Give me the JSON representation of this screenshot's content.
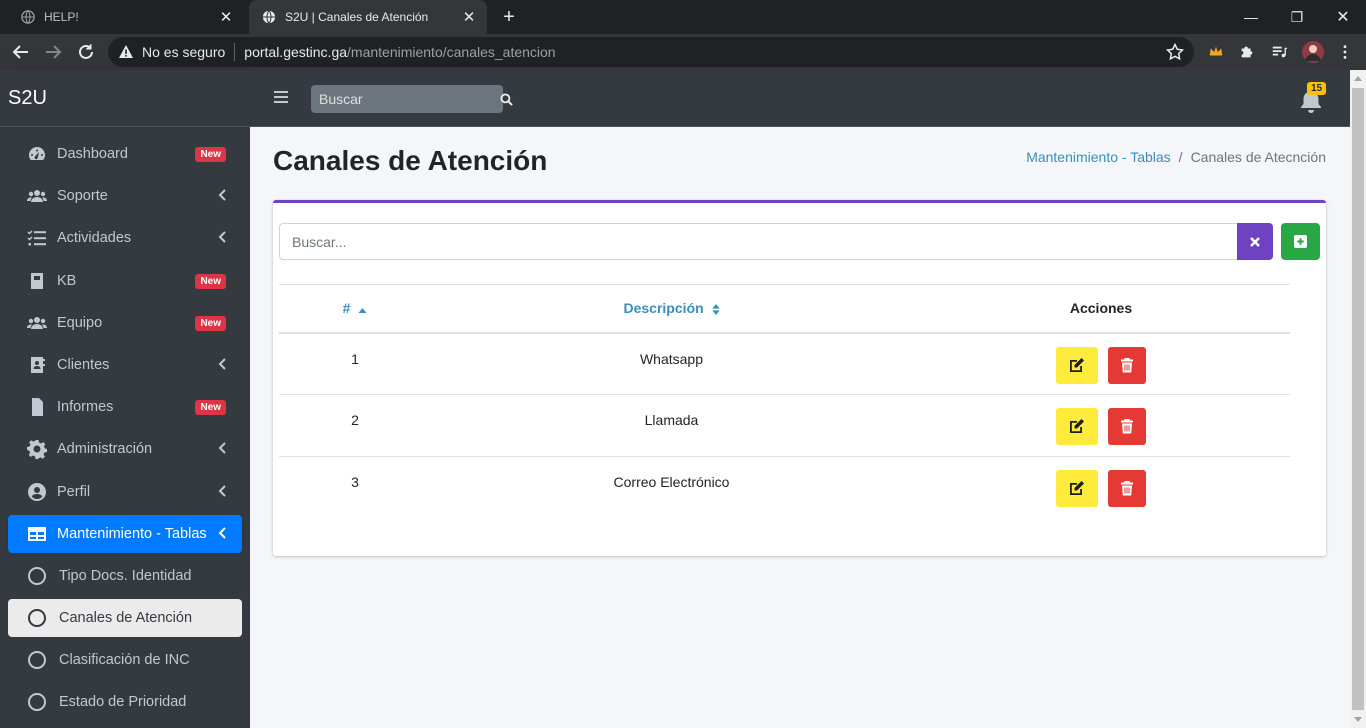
{
  "browser": {
    "tabs": [
      {
        "title": "HELP!",
        "active": false
      },
      {
        "title": "S2U | Canales de Atención",
        "active": true
      }
    ],
    "security_label": "No es seguro",
    "url_host": "portal.gestinc.ga",
    "url_path": "/mantenimiento/canales_atencion"
  },
  "app": {
    "brand": "S2U",
    "search_placeholder": "Buscar",
    "notifications_count": "15"
  },
  "sidebar": {
    "items": [
      {
        "label": "Dashboard",
        "icon": "tachometer-icon",
        "badge": "New"
      },
      {
        "label": "Soporte",
        "icon": "users-icon",
        "chevron": true
      },
      {
        "label": "Actividades",
        "icon": "tasks-icon",
        "chevron": true
      },
      {
        "label": "KB",
        "icon": "book-icon",
        "badge": "New"
      },
      {
        "label": "Equipo",
        "icon": "users-icon",
        "badge": "New"
      },
      {
        "label": "Clientes",
        "icon": "address-book-icon",
        "chevron": true
      },
      {
        "label": "Informes",
        "icon": "file-icon",
        "badge": "New"
      },
      {
        "label": "Administración",
        "icon": "cog-icon",
        "chevron": true
      },
      {
        "label": "Perfil",
        "icon": "user-circle-icon",
        "chevron": true
      },
      {
        "label": "Mantenimiento - Tablas",
        "icon": "table-icon",
        "chevron": true,
        "active": true
      },
      {
        "label": "Tipo Docs. Identidad",
        "icon": "circle-icon"
      },
      {
        "label": "Canales de Atención",
        "icon": "circle-icon",
        "selected": true
      },
      {
        "label": "Clasificación de INC",
        "icon": "circle-icon"
      },
      {
        "label": "Estado de Prioridad",
        "icon": "circle-icon"
      }
    ]
  },
  "page": {
    "title": "Canales de Atención",
    "breadcrumb": {
      "parent": "Mantenimiento - Tablas",
      "current": "Canales de Atecnción"
    },
    "filter_placeholder": "Buscar...",
    "table": {
      "headers": {
        "id": "#",
        "description": "Descripción",
        "actions": "Acciones"
      },
      "rows": [
        {
          "id": "1",
          "description": "Whatsapp"
        },
        {
          "id": "2",
          "description": "Llamada"
        },
        {
          "id": "3",
          "description": "Correo Electrónico"
        }
      ]
    }
  },
  "colors": {
    "sidebar_bg": "#343a40",
    "active_item": "#007bff",
    "card_accent": "#6f42c1",
    "add_button": "#28a745",
    "edit_button": "#ffeb3b",
    "delete_button": "#e53935",
    "link": "#3c8dbc"
  }
}
